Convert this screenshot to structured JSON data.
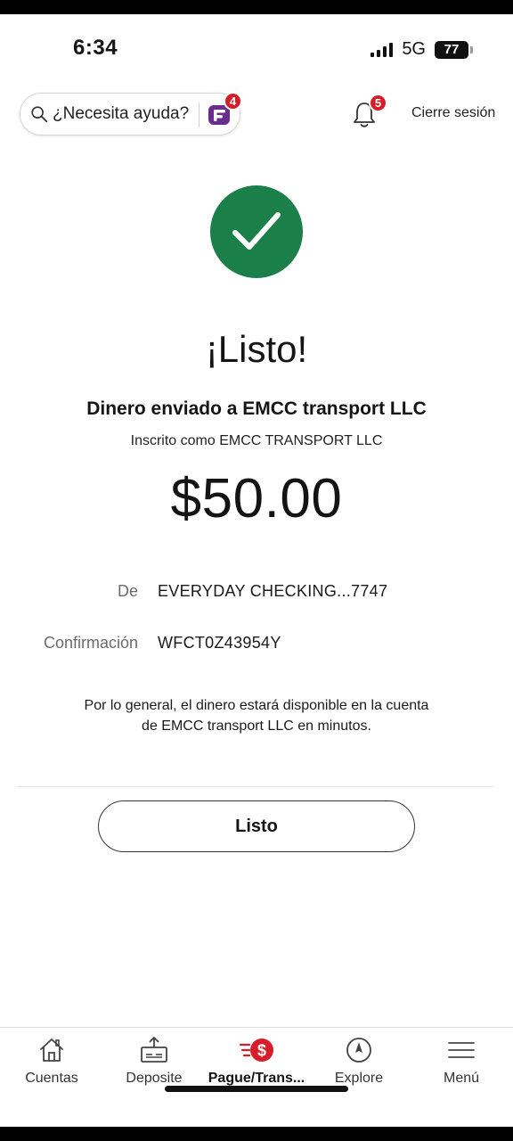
{
  "status_bar": {
    "time": "6:34",
    "network": "5G",
    "battery": "77"
  },
  "header": {
    "help_placeholder": "¿Necesita ayuda?",
    "help_badge": "4",
    "notifications_badge": "5",
    "signout_label": "Cierre sesión"
  },
  "confirmation": {
    "title": "¡Listo!",
    "sent_to": "Dinero enviado a EMCC transport LLC",
    "enrolled_as": "Inscrito como EMCC TRANSPORT LLC",
    "amount": "$50.00",
    "from_label": "De",
    "from_value": "EVERYDAY CHECKING...7747",
    "confirmation_label": "Confirmación",
    "confirmation_value": "WFCT0Z43954Y",
    "note": "Por lo general, el dinero estará disponible en la cuenta de EMCC transport LLC en minutos.",
    "done_button": "Listo"
  },
  "bottom_nav": {
    "items": [
      {
        "label": "Cuentas",
        "icon": "home-icon"
      },
      {
        "label": "Deposite",
        "icon": "deposit-icon"
      },
      {
        "label": "Pague/Trans...",
        "icon": "pay-transfer-icon",
        "active": true
      },
      {
        "label": "Explore",
        "icon": "compass-icon"
      },
      {
        "label": "Menú",
        "icon": "menu-icon"
      }
    ]
  },
  "colors": {
    "success_green": "#1b7f4a",
    "badge_red": "#d71e28",
    "brand_purple": "#6b2c8f"
  }
}
